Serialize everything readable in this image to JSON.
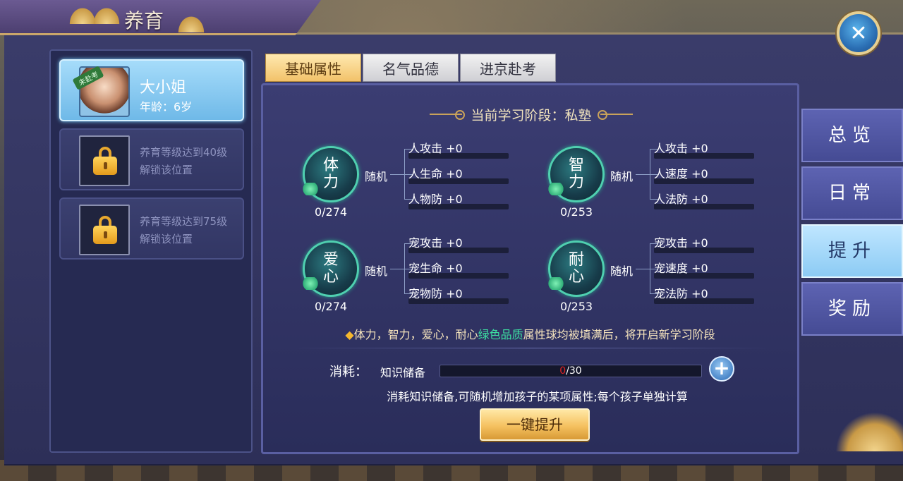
{
  "window": {
    "title": "养育",
    "close_icon": "close-icon"
  },
  "children": [
    {
      "name": "大小姐",
      "age": "年龄：6岁",
      "badge": "未赴考",
      "selected": true
    },
    {
      "locked": true,
      "unlock_line1": "养育等级达到40级",
      "unlock_line2": "解锁该位置"
    },
    {
      "locked": true,
      "unlock_line1": "养育等级达到75级",
      "unlock_line2": "解锁该位置"
    }
  ],
  "tabs": [
    {
      "label": "基础属性",
      "active": true
    },
    {
      "label": "名气品德",
      "active": false
    },
    {
      "label": "进京赴考",
      "active": false
    }
  ],
  "stage": "当前学习阶段：私塾",
  "attributes": [
    {
      "char1": "体",
      "char2": "力",
      "value": "0/274",
      "random_label": "随机",
      "stats": [
        "人攻击 +0",
        "人生命 +0",
        "人物防 +0"
      ]
    },
    {
      "char1": "智",
      "char2": "力",
      "value": "0/253",
      "random_label": "随机",
      "stats": [
        "人攻击 +0",
        "人速度 +0",
        "人法防 +0"
      ]
    },
    {
      "char1": "爱",
      "char2": "心",
      "value": "0/274",
      "random_label": "随机",
      "stats": [
        "宠攻击 +0",
        "宠生命 +0",
        "宠物防 +0"
      ]
    },
    {
      "char1": "耐",
      "char2": "心",
      "value": "0/253",
      "random_label": "随机",
      "stats": [
        "宠攻击 +0",
        "宠速度 +0",
        "宠法防 +0"
      ]
    }
  ],
  "note": {
    "diamond": "◆",
    "prefix": "体力，智力，爱心，耐心",
    "highlight": "绿色品质",
    "suffix": "属性球均被填满后，将开启新学习阶段"
  },
  "consume": {
    "label": "消耗：",
    "item_label": "知识储备",
    "current": "0",
    "max": "/30",
    "plus_icon": "plus-icon",
    "description": "消耗知识储备,可随机增加孩子的某项属性;每个孩子单独计算"
  },
  "upgrade_button": "一键提升",
  "side_tabs": [
    {
      "label": "总览",
      "active": false
    },
    {
      "label": "日常",
      "active": false
    },
    {
      "label": "提升",
      "active": true
    },
    {
      "label": "奖励",
      "active": false
    }
  ],
  "colors": {
    "accent_gold": "#f2c26a",
    "orb_ring": "#4fd0b0",
    "note_green": "#3de0a2",
    "active_side_tab": "#8ccbf4"
  }
}
